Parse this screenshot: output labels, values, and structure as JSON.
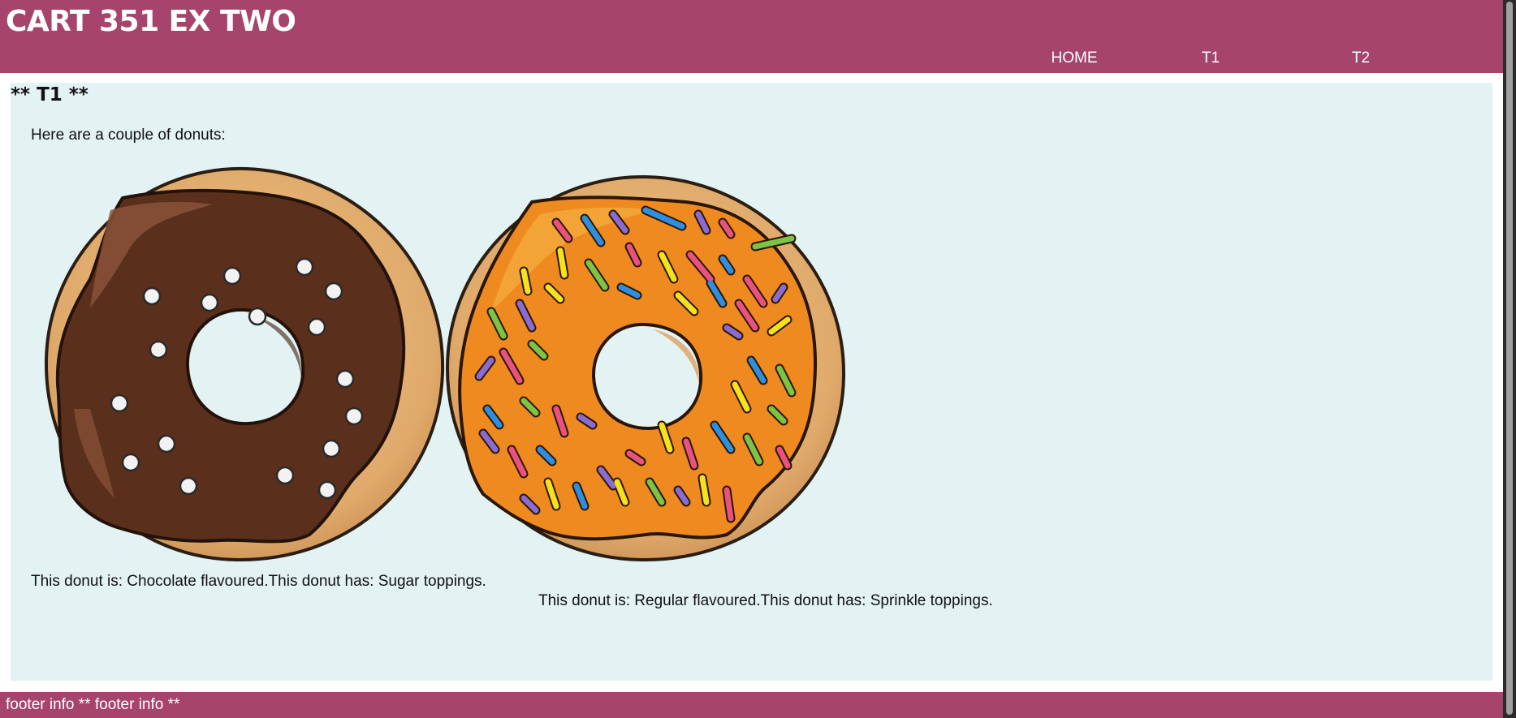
{
  "header": {
    "title": "CART 351 EX TWO",
    "nav": [
      {
        "label": "HOME"
      },
      {
        "label": "T1"
      },
      {
        "label": "T2"
      }
    ]
  },
  "main": {
    "section_title": "** T1 **",
    "intro": "Here are a couple of donuts:",
    "donuts": [
      {
        "caption": "This donut is: Chocolate flavoured.This donut has: Sugar toppings.",
        "flavour": "chocolate",
        "topping": "sugar"
      },
      {
        "caption": "This donut is: Regular flavoured.This donut has: Sprinkle toppings.",
        "flavour": "regular",
        "topping": "sprinkle"
      }
    ]
  },
  "footer": {
    "text": "footer info ** footer info **"
  },
  "colors": {
    "header_bg": "#a6446b",
    "main_bg": "#e3f2f3",
    "chocolate_icing": "#5a2f1c",
    "orange_icing": "#ee8a20",
    "dough": "#e8b878"
  }
}
